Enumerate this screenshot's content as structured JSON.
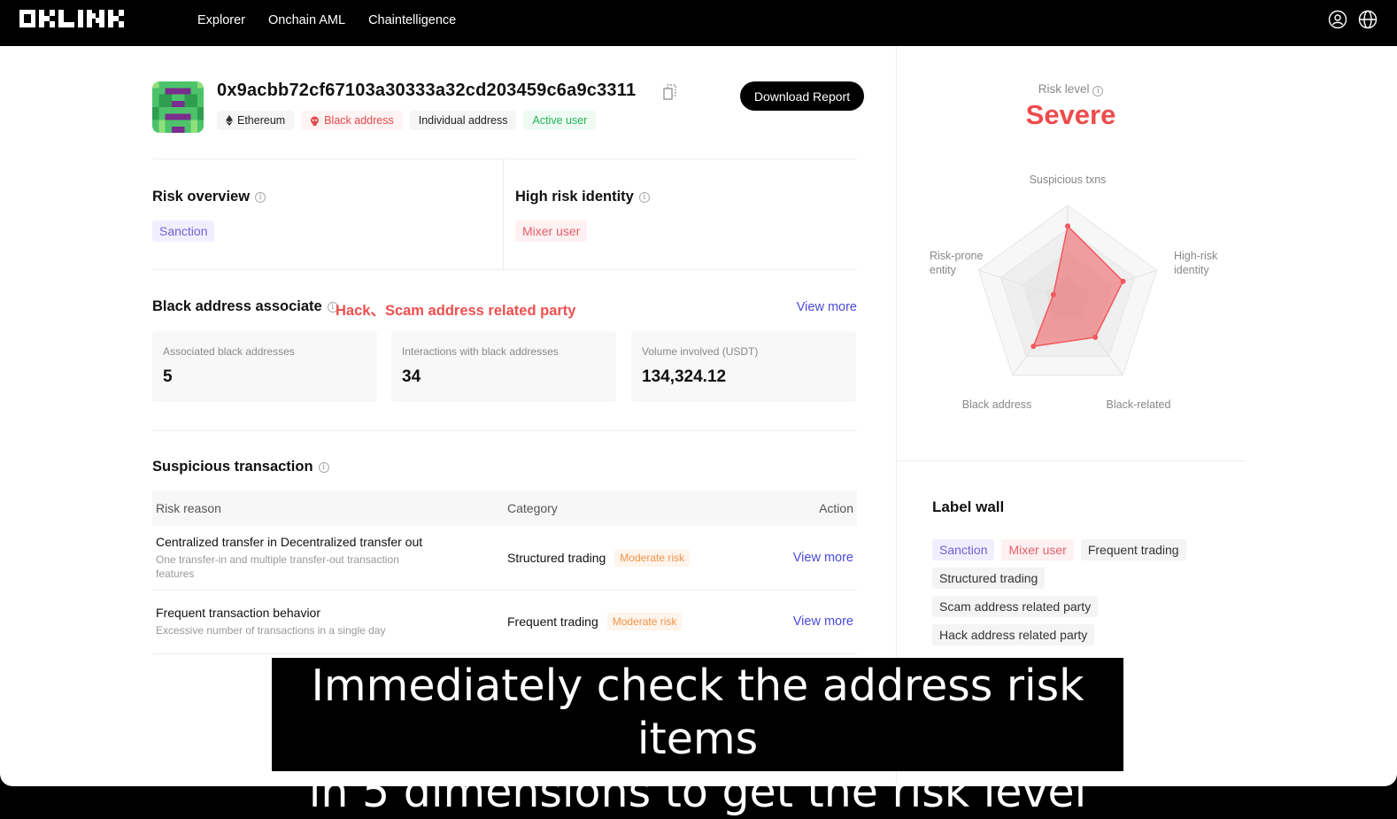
{
  "nav": {
    "logo_text": "OKLINK",
    "items": [
      "Explorer",
      "Onchain AML",
      "Chaintelligence"
    ]
  },
  "header": {
    "address": "0x9acbb72cf67103a30333a32cd203459c6a9c3311",
    "download_label": "Download Report",
    "tags": [
      {
        "label": "Ethereum",
        "kind": "chain"
      },
      {
        "label": "Black address",
        "kind": "red"
      },
      {
        "label": "Individual address",
        "kind": "neutral"
      },
      {
        "label": "Active user",
        "kind": "green"
      }
    ]
  },
  "risk_overview": {
    "title": "Risk overview",
    "chip": "Sanction"
  },
  "high_risk_identity": {
    "title": "High risk identity",
    "chip": "Mixer user"
  },
  "black_assoc": {
    "title": "Black address associate",
    "highlight": "Hack、Scam address related party",
    "view_more": "View more",
    "stats": [
      {
        "label": "Associated black addresses",
        "value": "5"
      },
      {
        "label": "Interactions with black addresses",
        "value": "34"
      },
      {
        "label": "Volume involved (USDT)",
        "value": "134,324.12"
      }
    ]
  },
  "suspicious": {
    "title": "Suspicious transaction",
    "headers": {
      "reason": "Risk reason",
      "category": "Category",
      "action": "Action"
    },
    "rows": [
      {
        "reason": "Centralized transfer in Decentralized transfer out",
        "desc": "One transfer-in and multiple transfer-out transaction features",
        "category": "Structured trading",
        "risk": "Moderate risk",
        "action": "View more"
      },
      {
        "reason": "Frequent transaction behavior",
        "desc": "Excessive number of transactions in a single day",
        "category": "Frequent trading",
        "risk": "Moderate risk",
        "action": "View more"
      }
    ]
  },
  "risk_level": {
    "label": "Risk level",
    "value": "Severe"
  },
  "radar": {
    "axes": [
      {
        "label": "Suspicious txns",
        "value": 0.78
      },
      {
        "label": "High-risk identity",
        "value": 0.62
      },
      {
        "label": "Black-related",
        "value": 0.5
      },
      {
        "label": "Black address",
        "value": 0.62
      },
      {
        "label": "Risk-prone entity",
        "value": 0.16
      }
    ],
    "color": "#f05a5f"
  },
  "label_wall": {
    "title": "Label wall",
    "labels": [
      {
        "text": "Sanction",
        "kind": "purple"
      },
      {
        "text": "Mixer user",
        "kind": "pink"
      },
      {
        "text": "Frequent trading",
        "kind": "neutral"
      },
      {
        "text": "Structured trading",
        "kind": "neutral"
      },
      {
        "text": "Scam address related party",
        "kind": "neutral"
      },
      {
        "text": "Hack address related party",
        "kind": "neutral"
      }
    ]
  },
  "caption": {
    "line1": "Immediately check the address risk items",
    "line2": "in 5 dimensions to get the risk level"
  }
}
